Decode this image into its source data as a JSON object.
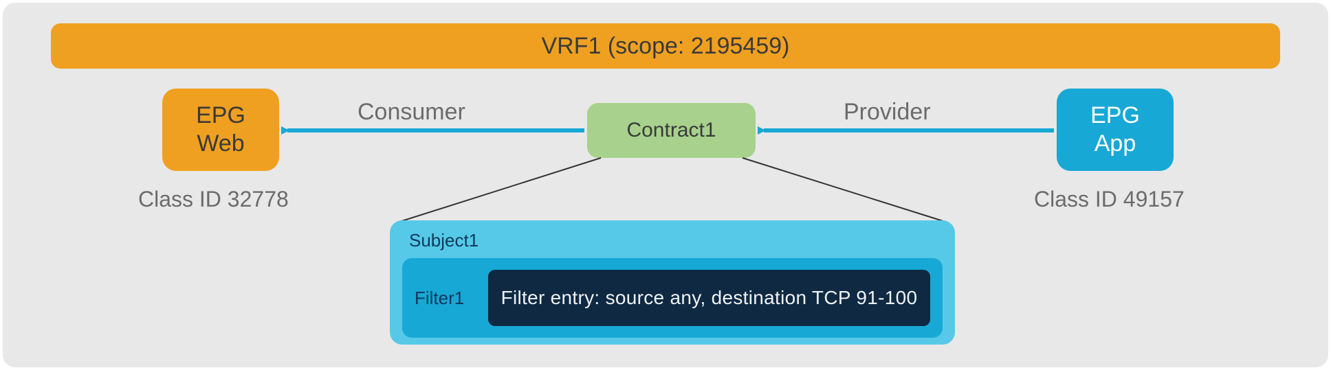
{
  "vrf": {
    "label": "VRF1 (scope: 2195459)"
  },
  "epg_web": {
    "label": "EPG\nWeb",
    "class_id": "Class ID 32778"
  },
  "epg_app": {
    "label": "EPG\nApp",
    "class_id": "Class ID 49157"
  },
  "contract": {
    "label": "Contract1"
  },
  "relations": {
    "consumer": "Consumer",
    "provider": "Provider"
  },
  "subject": {
    "label": "Subject1",
    "filter": {
      "label": "Filter1",
      "entry": "Filter entry: source any, destination TCP 91-100"
    }
  },
  "colors": {
    "orange": "#f0a020",
    "blue": "#17a8d6",
    "lightblue": "#57c9e8",
    "green": "#a7d18c",
    "dark": "#0f2942",
    "grey": "#6b6b6b"
  }
}
